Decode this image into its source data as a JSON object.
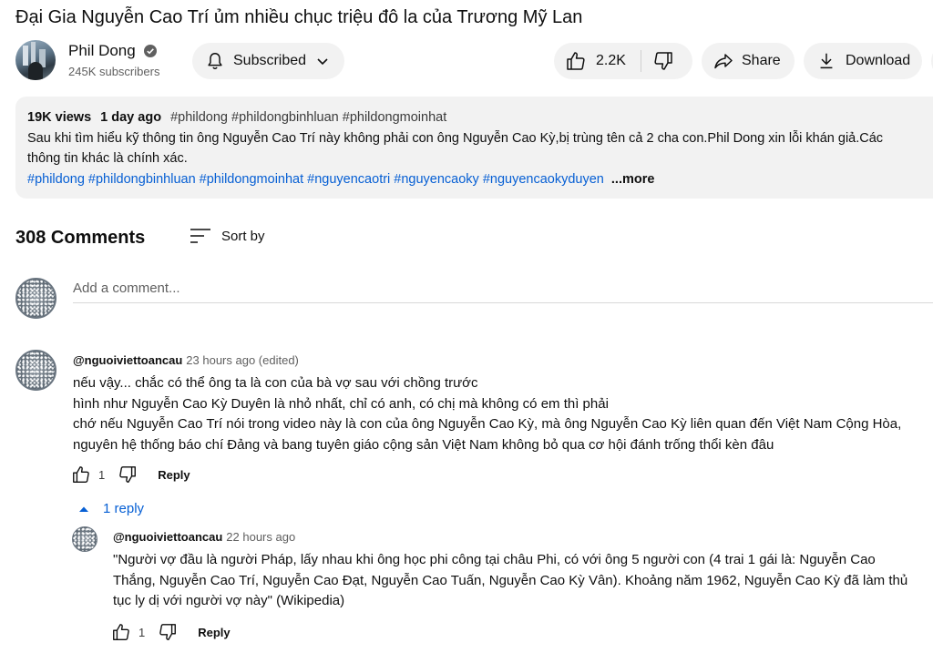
{
  "video": {
    "title": "Đại Gia Nguyễn Cao Trí ủm nhiều chục triệu đô la của Trương Mỹ Lan"
  },
  "channel": {
    "name": "Phil Dong",
    "subscribers": "245K subscribers",
    "subscribe_label": "Subscribed"
  },
  "actions": {
    "like_count": "2.2K",
    "share_label": "Share",
    "download_label": "Download"
  },
  "description": {
    "views": "19K views",
    "date": "1 day ago",
    "top_tags": "#phildong #phildongbinhluan #phildongmoinhat",
    "text_line1": "Sau khi tìm hiểu kỹ thông tin ông Nguyễn Cao Trí này không phải con ông Nguyễn Cao Kỳ,bị trùng tên cả 2 cha con.Phil Dong xin lỗi khán giả.Các",
    "text_line2": "thông tin khác là chính xác.",
    "hashtags": "#phildong #phildongbinhluan #phildongmoinhat #nguyencaotri #nguyencaoky #nguyencaokyduyen",
    "more_label": "...more"
  },
  "comments": {
    "count_label": "308 Comments",
    "sort_label": "Sort by",
    "add_placeholder": "Add a comment...",
    "items": [
      {
        "author": "@nguoiviettoancau",
        "time": "23 hours ago (edited)",
        "lines": [
          "nếu vậy... chắc có thể ông ta là con của bà vợ sau với chồng trước",
          "hình như Nguyễn Cao Kỳ Duyên là nhỏ nhất, chỉ có anh, có chị mà không có em thì phải",
          "chớ nếu Nguyễn Cao Trí nói trong video này là con của ông Nguyễn Cao Kỳ, mà ông Nguyễn Cao Kỳ liên quan đến Việt Nam Cộng Hòa,",
          "nguyên hệ thống báo chí Đảng và bang tuyên giáo cộng sản Việt Nam không bỏ qua cơ hội đánh trống thổi kèn đâu"
        ],
        "likes": "1",
        "reply_label": "Reply",
        "replies_toggle": "1 reply",
        "replies": [
          {
            "author": "@nguoiviettoancau",
            "time": "22 hours ago",
            "lines": [
              "\"Người vợ đầu là người Pháp, lấy nhau khi ông học phi công tại châu Phi, có với ông 5 người con (4 trai 1 gái là: Nguyễn Cao",
              "Thắng, Nguyễn Cao Trí, Nguyễn Cao Đạt, Nguyễn Cao Tuấn, Nguyễn Cao Kỳ Vân). Khoảng năm 1962, Nguyễn Cao Kỳ đã làm thủ",
              "tục ly dị với người vợ này\" (Wikipedia)"
            ],
            "likes": "1",
            "reply_label": "Reply"
          }
        ]
      }
    ]
  }
}
